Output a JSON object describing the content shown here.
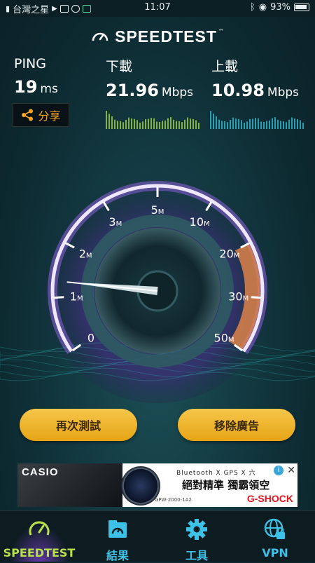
{
  "status_bar": {
    "carrier": "台灣之星",
    "time": "11:07",
    "battery": "93%"
  },
  "header": {
    "title": "SPEEDTEST",
    "tm": "™"
  },
  "metrics": {
    "ping": {
      "label": "PING",
      "value": "19",
      "unit": "ms"
    },
    "download": {
      "label": "下載",
      "value": "21.96",
      "unit": "Mbps"
    },
    "upload": {
      "label": "上載",
      "value": "10.98",
      "unit": "Mbps"
    }
  },
  "share": {
    "label": "分享"
  },
  "gauge": {
    "ticks": [
      {
        "num": "0",
        "unit": ""
      },
      {
        "num": "1",
        "unit": "M"
      },
      {
        "num": "2",
        "unit": "M"
      },
      {
        "num": "3",
        "unit": "M"
      },
      {
        "num": "5",
        "unit": "M"
      },
      {
        "num": "10",
        "unit": "M"
      },
      {
        "num": "20",
        "unit": "M"
      },
      {
        "num": "30",
        "unit": "M"
      },
      {
        "num": "50",
        "unit": "M"
      }
    ],
    "needle_value_mbps": 1.3
  },
  "buttons": {
    "retest": "再次測試",
    "remove_ads": "移除廣告"
  },
  "ad": {
    "brand": "CASIO",
    "line1": "Bluetooth  X  GPS  X  六",
    "line2": "絕對精準  獨霸領空",
    "model": "GPW-2000-1A2",
    "product": "G-SHOCK",
    "info": "i",
    "close": "✕"
  },
  "nav": {
    "items": [
      {
        "label": "SPEEDTEST",
        "icon": "speedometer-icon"
      },
      {
        "label": "結果",
        "icon": "results-icon"
      },
      {
        "label": "工具",
        "icon": "gear-icon"
      },
      {
        "label": "VPN",
        "icon": "globe-lock-icon"
      }
    ]
  },
  "colors": {
    "accent": "#3ec1e6",
    "active": "#b9e24a",
    "button": "#f0b732",
    "gauge_arc": "#8c62d8",
    "gauge_fill": "#e8874a"
  }
}
